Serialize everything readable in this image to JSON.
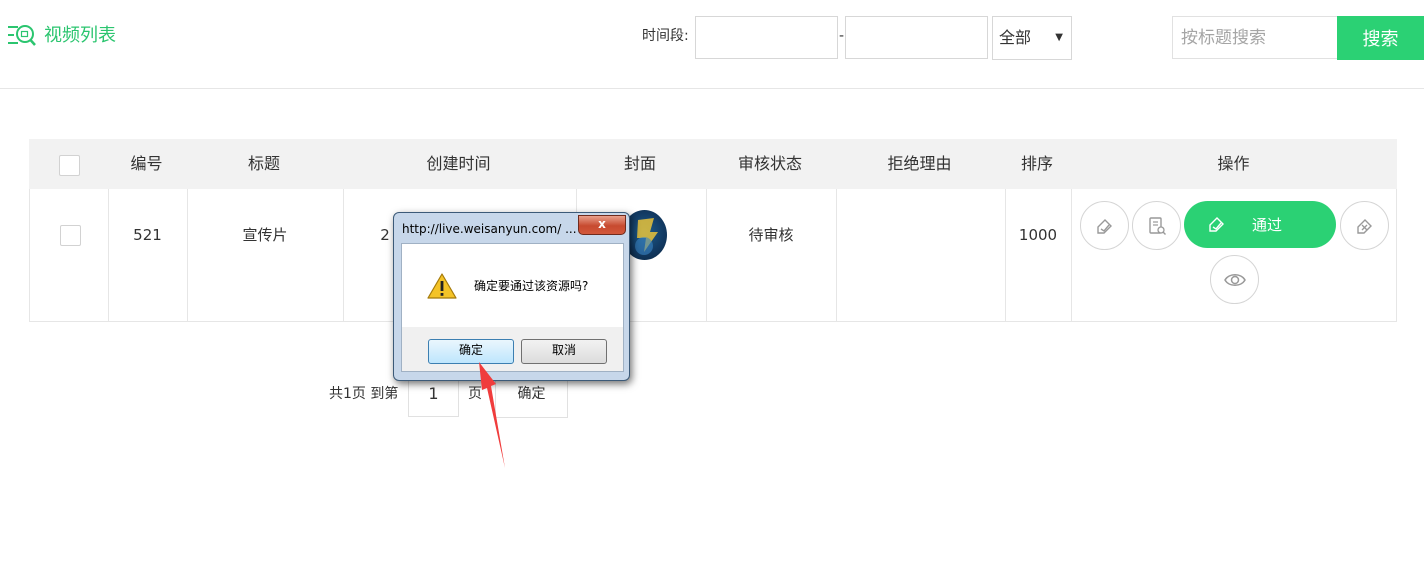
{
  "header": {
    "title": "视频列表",
    "time_label": "时间段:",
    "date_separator": "-",
    "date_start_value": "",
    "date_end_value": "",
    "status_select": "全部",
    "search_placeholder": "按标题搜索",
    "search_button": "搜索"
  },
  "table": {
    "columns": [
      "编号",
      "标题",
      "创建时间",
      "封面",
      "审核状态",
      "拒绝理由",
      "排序",
      "操作"
    ],
    "rows": [
      {
        "id": "521",
        "title": "宣传片",
        "created_partial": "2",
        "status": "待审核",
        "reject_reason": "",
        "sort": "1000",
        "actions": {
          "pass_label": "通过"
        }
      }
    ]
  },
  "pagination": {
    "total_text": "共1页 到第",
    "page_value": "1",
    "page_unit": "页",
    "go_button": "确定"
  },
  "dialog": {
    "title": "http://live.weisanyun.com/ ...",
    "close_label": "x",
    "message": "确定要通过该资源吗?",
    "ok_button": "确定",
    "cancel_button": "取消"
  },
  "colors": {
    "accent": "#2bd174",
    "title_green": "#2bc56f",
    "annotation_arrow": "#f03c3c"
  },
  "icons": {
    "title": "video-list-icon",
    "actions": [
      "edit-icon",
      "review-icon",
      "approve-icon",
      "reject-icon",
      "preview-icon"
    ],
    "dialog": "warning-icon"
  }
}
